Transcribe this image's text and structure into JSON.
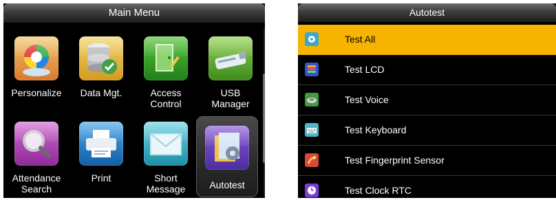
{
  "main_menu": {
    "title": "Main Menu",
    "items": [
      {
        "label_line1": "Personalize",
        "label_line2": "",
        "icon": "personalize-icon"
      },
      {
        "label_line1": "Data Mgt.",
        "label_line2": "",
        "icon": "database-icon"
      },
      {
        "label_line1": "Access",
        "label_line2": "Control",
        "icon": "door-icon"
      },
      {
        "label_line1": "USB",
        "label_line2": "Manager",
        "icon": "usb-drive-icon"
      },
      {
        "label_line1": "Attendance",
        "label_line2": "Search",
        "icon": "magnifier-icon"
      },
      {
        "label_line1": "Print",
        "label_line2": "",
        "icon": "printer-icon"
      },
      {
        "label_line1": "Short",
        "label_line2": "Message",
        "icon": "envelope-icon"
      },
      {
        "label_line1": "Autotest",
        "label_line2": "",
        "icon": "autotest-icon"
      }
    ],
    "selected_item": "Autotest"
  },
  "autotest": {
    "title": "Autotest",
    "items": [
      {
        "label": "Test All",
        "icon": "test-all-icon"
      },
      {
        "label": "Test LCD",
        "icon": "lcd-icon"
      },
      {
        "label": "Test Voice",
        "icon": "speaker-icon"
      },
      {
        "label": "Test Keyboard",
        "icon": "keyboard-icon"
      },
      {
        "label": "Test Fingerprint Sensor",
        "icon": "fingerprint-icon"
      },
      {
        "label": "Test Clock RTC",
        "icon": "clock-icon"
      }
    ],
    "selected_item": "Test All"
  },
  "colors": {
    "selection_highlight": "#f6b400",
    "screen_background": "#000000",
    "text": "#ffffff"
  }
}
